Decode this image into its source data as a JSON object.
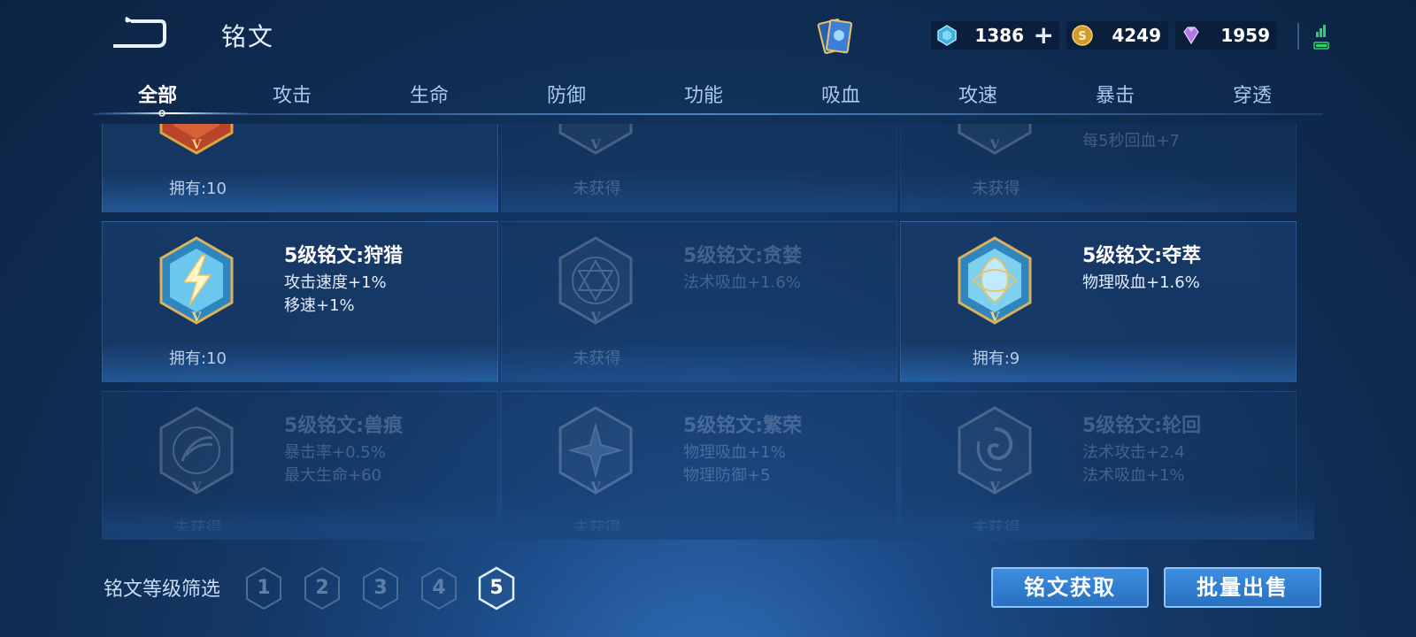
{
  "header": {
    "title": "铭文",
    "currencies": [
      {
        "name": "diamond",
        "amount": "1386"
      },
      {
        "name": "gold-coin",
        "amount": "4249"
      },
      {
        "name": "gem",
        "amount": "1959"
      }
    ]
  },
  "tabs": [
    {
      "label": "全部",
      "active": true
    },
    {
      "label": "攻击",
      "active": false
    },
    {
      "label": "生命",
      "active": false
    },
    {
      "label": "防御",
      "active": false
    },
    {
      "label": "功能",
      "active": false
    },
    {
      "label": "吸血",
      "active": false
    },
    {
      "label": "攻速",
      "active": false
    },
    {
      "label": "暴击",
      "active": false
    },
    {
      "label": "穿透",
      "active": false
    }
  ],
  "rows": [
    {
      "cards": [
        {
          "name": "",
          "attrs": [],
          "owned": "拥有:10",
          "locked": false,
          "partial_attr": ""
        },
        {
          "name": "",
          "attrs": [],
          "owned": "未获得",
          "locked": true
        },
        {
          "name": "",
          "attrs": [
            "每5秒回血+7"
          ],
          "owned": "未获得",
          "locked": true
        }
      ]
    },
    {
      "cards": [
        {
          "name": "5级铭文:狩猎",
          "attrs": [
            "攻击速度+1%",
            "移速+1%"
          ],
          "owned": "拥有:10",
          "locked": false
        },
        {
          "name": "5级铭文:贪婪",
          "attrs": [
            "法术吸血+1.6%"
          ],
          "owned": "未获得",
          "locked": true
        },
        {
          "name": "5级铭文:夺萃",
          "attrs": [
            "物理吸血+1.6%"
          ],
          "owned": "拥有:9",
          "locked": false
        }
      ]
    },
    {
      "cards": [
        {
          "name": "5级铭文:兽痕",
          "attrs": [
            "暴击率+0.5%",
            "最大生命+60"
          ],
          "owned": "未获得",
          "locked": true
        },
        {
          "name": "5级铭文:繁荣",
          "attrs": [
            "物理吸血+1%",
            "物理防御+5"
          ],
          "owned": "未获得",
          "locked": true
        },
        {
          "name": "5级铭文:轮回",
          "attrs": [
            "法术攻击+2.4",
            "法术吸血+1%"
          ],
          "owned": "未获得",
          "locked": true
        }
      ]
    }
  ],
  "filter": {
    "label": "铭文等级筛选",
    "levels": [
      "1",
      "2",
      "3",
      "4",
      "5"
    ],
    "selected": "5"
  },
  "actions": {
    "acquire": "铭文获取",
    "bulk_sell": "批量出售"
  },
  "colors": {
    "accent": "#3c8ee0",
    "active_text": "#ffffff",
    "inactive_tab": "#a8c6ee",
    "emblem_gold": "#c9a24a",
    "emblem_blue": "#4fb3e6",
    "emblem_red": "#b8442a"
  }
}
